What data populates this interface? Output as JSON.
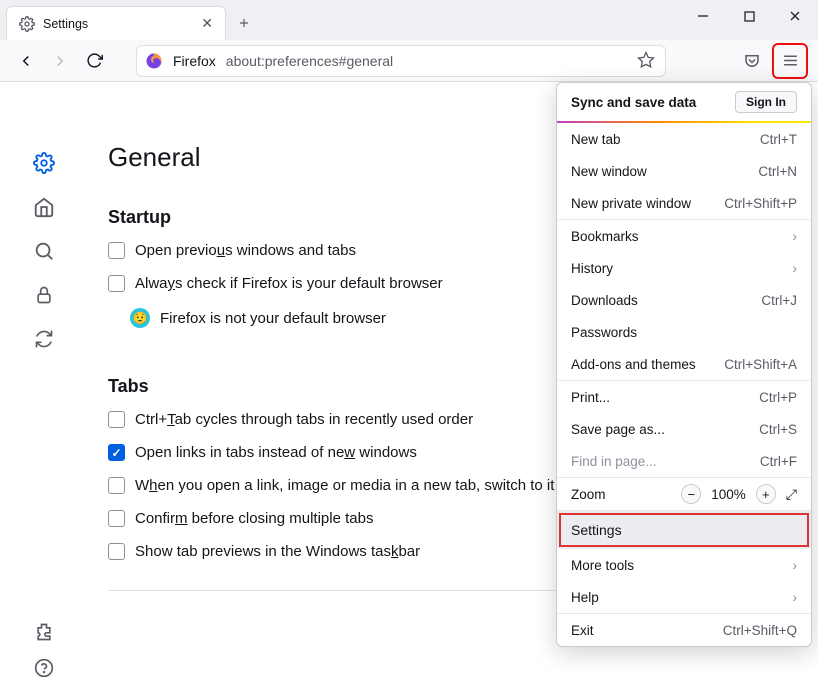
{
  "window": {
    "tab_title": "Settings"
  },
  "urlbar": {
    "identity": "Firefox",
    "url": "about:preferences#general"
  },
  "page": {
    "heading": "General",
    "startup": {
      "title": "Startup",
      "restore": "Open previous windows and tabs",
      "check_default": "Always check if Firefox is your default browser",
      "not_default": "Firefox is not your default browser"
    },
    "tabs": {
      "title": "Tabs",
      "ctrl_tab": "Ctrl+Tab cycles through tabs in recently used order",
      "open_links": "Open links in tabs instead of new windows",
      "switch_to": "When you open a link, image or media in a new tab, switch to it",
      "confirm_close": "Confirm before closing multiple tabs",
      "taskbar_preview": "Show tab previews in the Windows taskbar"
    }
  },
  "menu": {
    "sync_header": "Sync and save data",
    "sign_in": "Sign In",
    "new_tab": {
      "label": "New tab",
      "shortcut": "Ctrl+T"
    },
    "new_window": {
      "label": "New window",
      "shortcut": "Ctrl+N"
    },
    "new_private": {
      "label": "New private window",
      "shortcut": "Ctrl+Shift+P"
    },
    "bookmarks": "Bookmarks",
    "history": "History",
    "downloads": {
      "label": "Downloads",
      "shortcut": "Ctrl+J"
    },
    "passwords": "Passwords",
    "addons": {
      "label": "Add-ons and themes",
      "shortcut": "Ctrl+Shift+A"
    },
    "print": {
      "label": "Print...",
      "shortcut": "Ctrl+P"
    },
    "save_as": {
      "label": "Save page as...",
      "shortcut": "Ctrl+S"
    },
    "find": {
      "label": "Find in page...",
      "shortcut": "Ctrl+F"
    },
    "zoom": {
      "label": "Zoom",
      "value": "100%"
    },
    "settings": "Settings",
    "more_tools": "More tools",
    "help": "Help",
    "exit": {
      "label": "Exit",
      "shortcut": "Ctrl+Shift+Q"
    }
  }
}
